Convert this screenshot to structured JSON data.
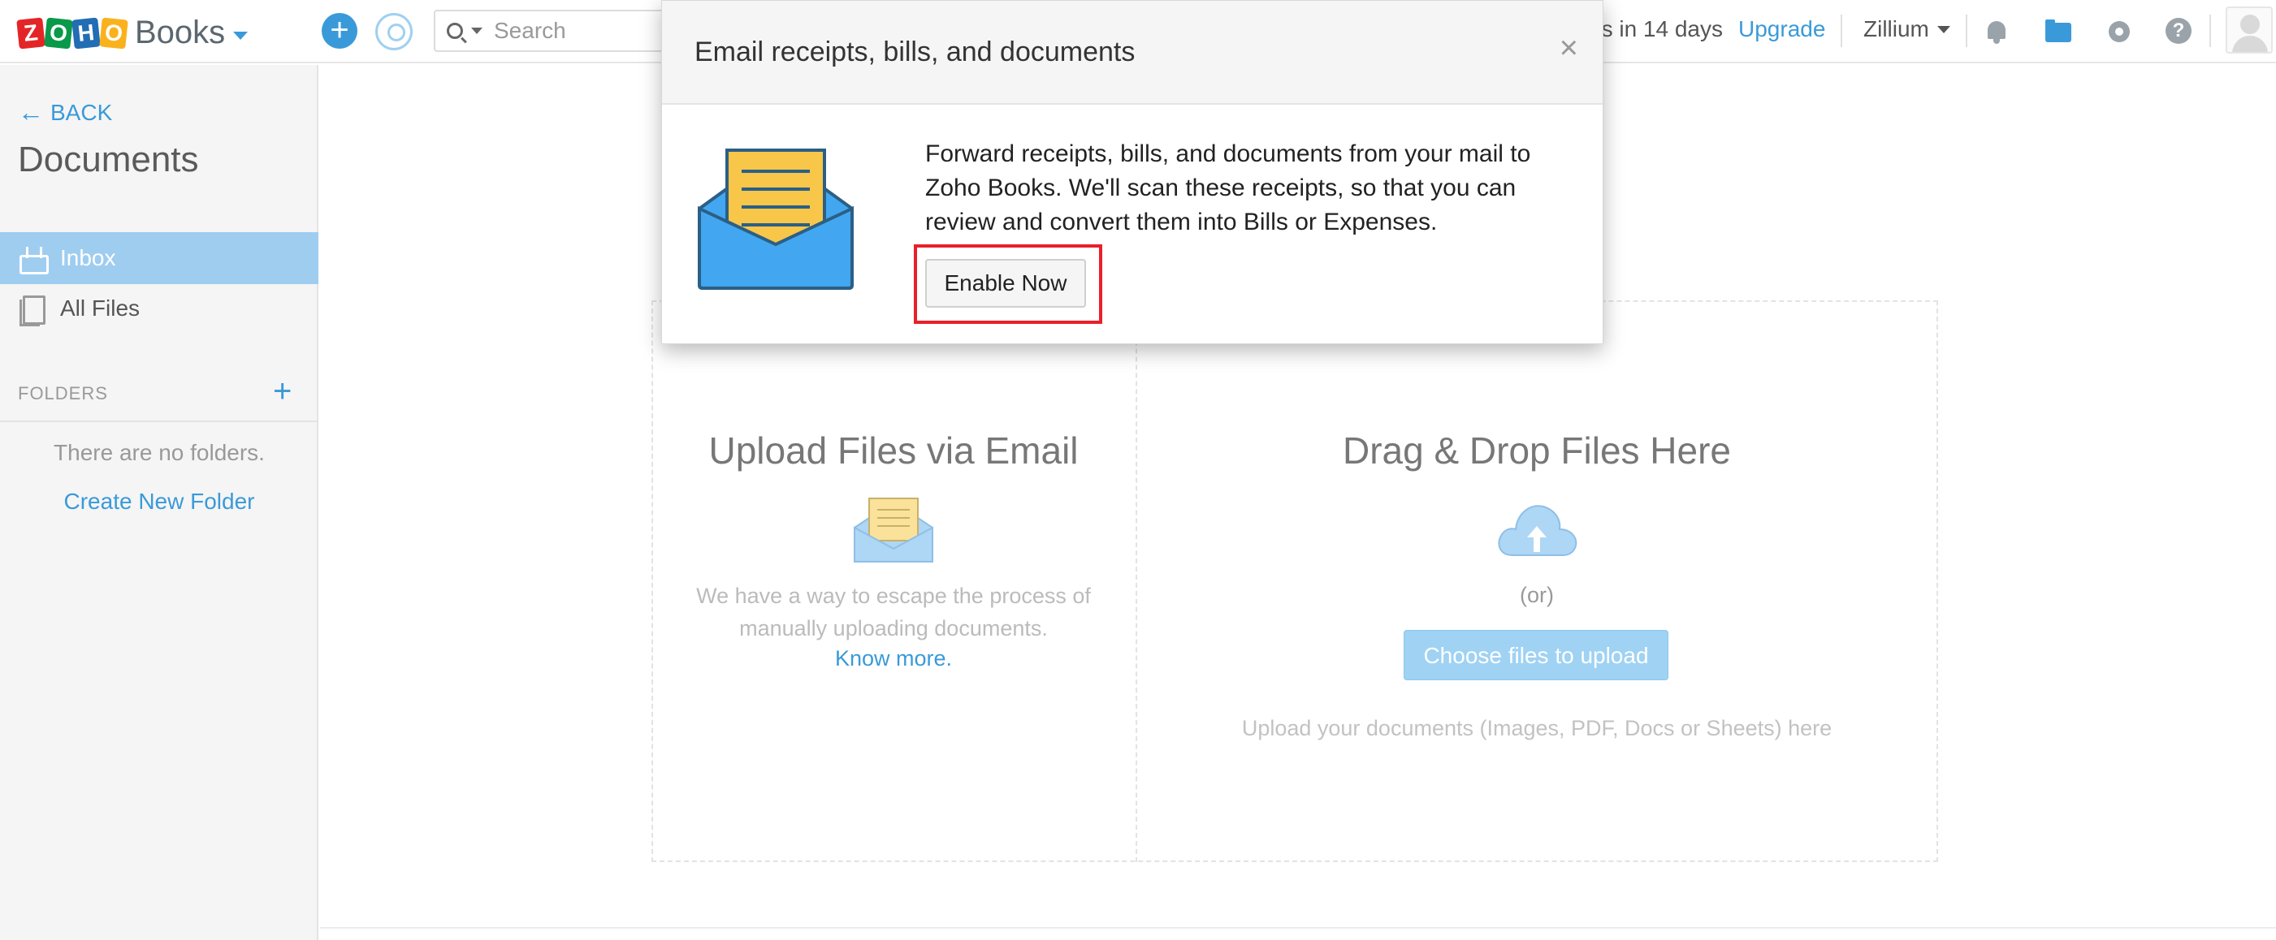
{
  "topbar": {
    "brand_letters": [
      "Z",
      "O",
      "H",
      "O"
    ],
    "brand_product": "Books",
    "search_placeholder": "Search",
    "trial_text": "es in 14 days",
    "upgrade_label": "Upgrade",
    "org_name": "Zillium"
  },
  "sidebar": {
    "back_label": "BACK",
    "title": "Documents",
    "items": [
      {
        "label": "Inbox",
        "icon": "inbox-icon",
        "active": true
      },
      {
        "label": "All Files",
        "icon": "file-icon",
        "active": false
      }
    ],
    "folders_heading": "FOLDERS",
    "no_folders_text": "There are no folders.",
    "create_folder_label": "Create New Folder"
  },
  "main": {
    "email_title": "Upload Files via Email",
    "email_desc": "We have a way to escape the process of manually uploading documents.",
    "know_more_label": "Know more.",
    "drop_title": "Drag & Drop Files Here",
    "or_text": "(or)",
    "choose_label": "Choose files to upload",
    "upload_hint": "Upload your documents (Images, PDF, Docs or Sheets) here"
  },
  "modal": {
    "title": "Email receipts, bills, and documents",
    "close_symbol": "×",
    "body": "Forward receipts, bills, and documents from your mail to Zoho Books. We'll scan these receipts, so that you can review and convert them into Bills or Expenses.",
    "enable_label": "Enable Now"
  },
  "colors": {
    "accent": "#3a9ad9",
    "sidebar_active": "#9fcdf0",
    "highlight_border": "#e8202a",
    "envelope_blue": "#42a7f0",
    "envelope_paper": "#f8c648"
  }
}
